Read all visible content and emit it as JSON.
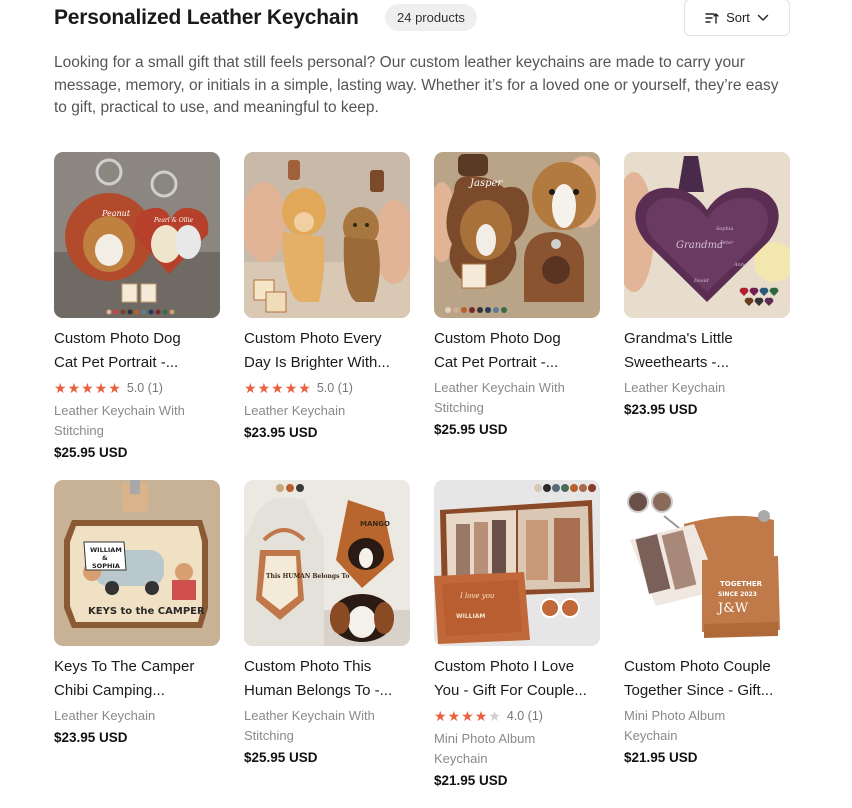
{
  "header": {
    "title": "Personalized Leather Keychain",
    "count": "24 products",
    "sort_label": "Sort"
  },
  "description": "Looking for a small gift that still feels personal? Our custom leather keychains are made to carry your message, memory, or initials in a simple, lasting way. Whether it’s for a loved one or yourself, they’re easy to gift, practical to use, and meaningful to keep.",
  "products": [
    {
      "title_l1": "Custom Photo Dog",
      "title_l2": "Cat Pet Portrait -...",
      "rating": "5.0 (1)",
      "stars": 5,
      "category": "Leather Keychain With Stitching",
      "price": "$25.95 USD",
      "image_text_1": "Peanut",
      "image_text_2": "Pearl & Ollie"
    },
    {
      "title_l1": "Custom Photo Every",
      "title_l2": "Day Is Brighter With...",
      "rating": "5.0 (1)",
      "stars": 5,
      "category": "Leather Keychain",
      "price": "$23.95 USD"
    },
    {
      "title_l1": "Custom Photo Dog",
      "title_l2": "Cat Pet Portrait -...",
      "rating": "",
      "stars": 0,
      "category": "Leather Keychain With Stitching",
      "price": "$25.95 USD",
      "image_text_1": "Jasper"
    },
    {
      "title_l1": "Grandma's Little",
      "title_l2": "Sweethearts -...",
      "rating": "",
      "stars": 0,
      "category": "Leather Keychain",
      "price": "$23.95 USD",
      "image_text_1": "Grandma",
      "image_text_2": "Sophia",
      "image_text_3": "Peter",
      "image_text_4": "Anna",
      "image_text_5": "David"
    },
    {
      "title_l1": "Keys To The Camper",
      "title_l2": "Chibi Camping...",
      "rating": "",
      "stars": 0,
      "category": "Leather Keychain",
      "price": "$23.95 USD",
      "image_text_1": "WILLIAM",
      "image_text_2": "&",
      "image_text_3": "SOPHIA",
      "image_text_4": "KEYS to the CAMPER"
    },
    {
      "title_l1": "Custom Photo This",
      "title_l2": "Human Belongs To -...",
      "rating": "",
      "stars": 0,
      "category": "Leather Keychain With Stitching",
      "price": "$25.95 USD",
      "image_text_1": "MANGO",
      "image_text_2": "This HUMAN Belongs To"
    },
    {
      "title_l1": "Custom Photo I Love",
      "title_l2": "You - Gift For Couple...",
      "rating": "4.0 (1)",
      "stars": 4,
      "category": "Mini Photo Album Keychain",
      "price": "$21.95 USD",
      "image_text_1": "I love you",
      "image_text_2": "WILLIAM"
    },
    {
      "title_l1": "Custom Photo Couple",
      "title_l2": "Together Since - Gift...",
      "rating": "",
      "stars": 0,
      "category": "Mini Photo Album Keychain",
      "price": "$21.95 USD",
      "image_text_1": "TOGETHER",
      "image_text_2": "SINCE 2023",
      "image_text_3": "J&W"
    }
  ],
  "colors": {
    "star_on": "#e8603c",
    "star_off": "#d0d0d0",
    "leather": "#b8612f",
    "badge_bg": "#efefef"
  }
}
